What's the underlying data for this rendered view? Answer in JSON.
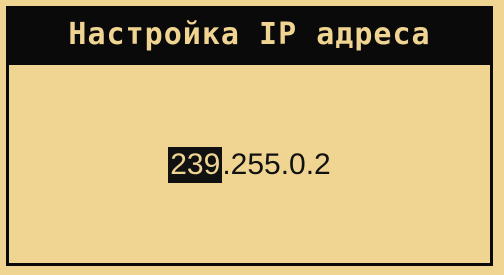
{
  "screen": {
    "title": "Настройка IP адреса",
    "ip": {
      "edit_octet": "239",
      "rest": ".255.0.2"
    }
  },
  "colors": {
    "background": "#f0d592",
    "foreground": "#0a0a0a"
  }
}
